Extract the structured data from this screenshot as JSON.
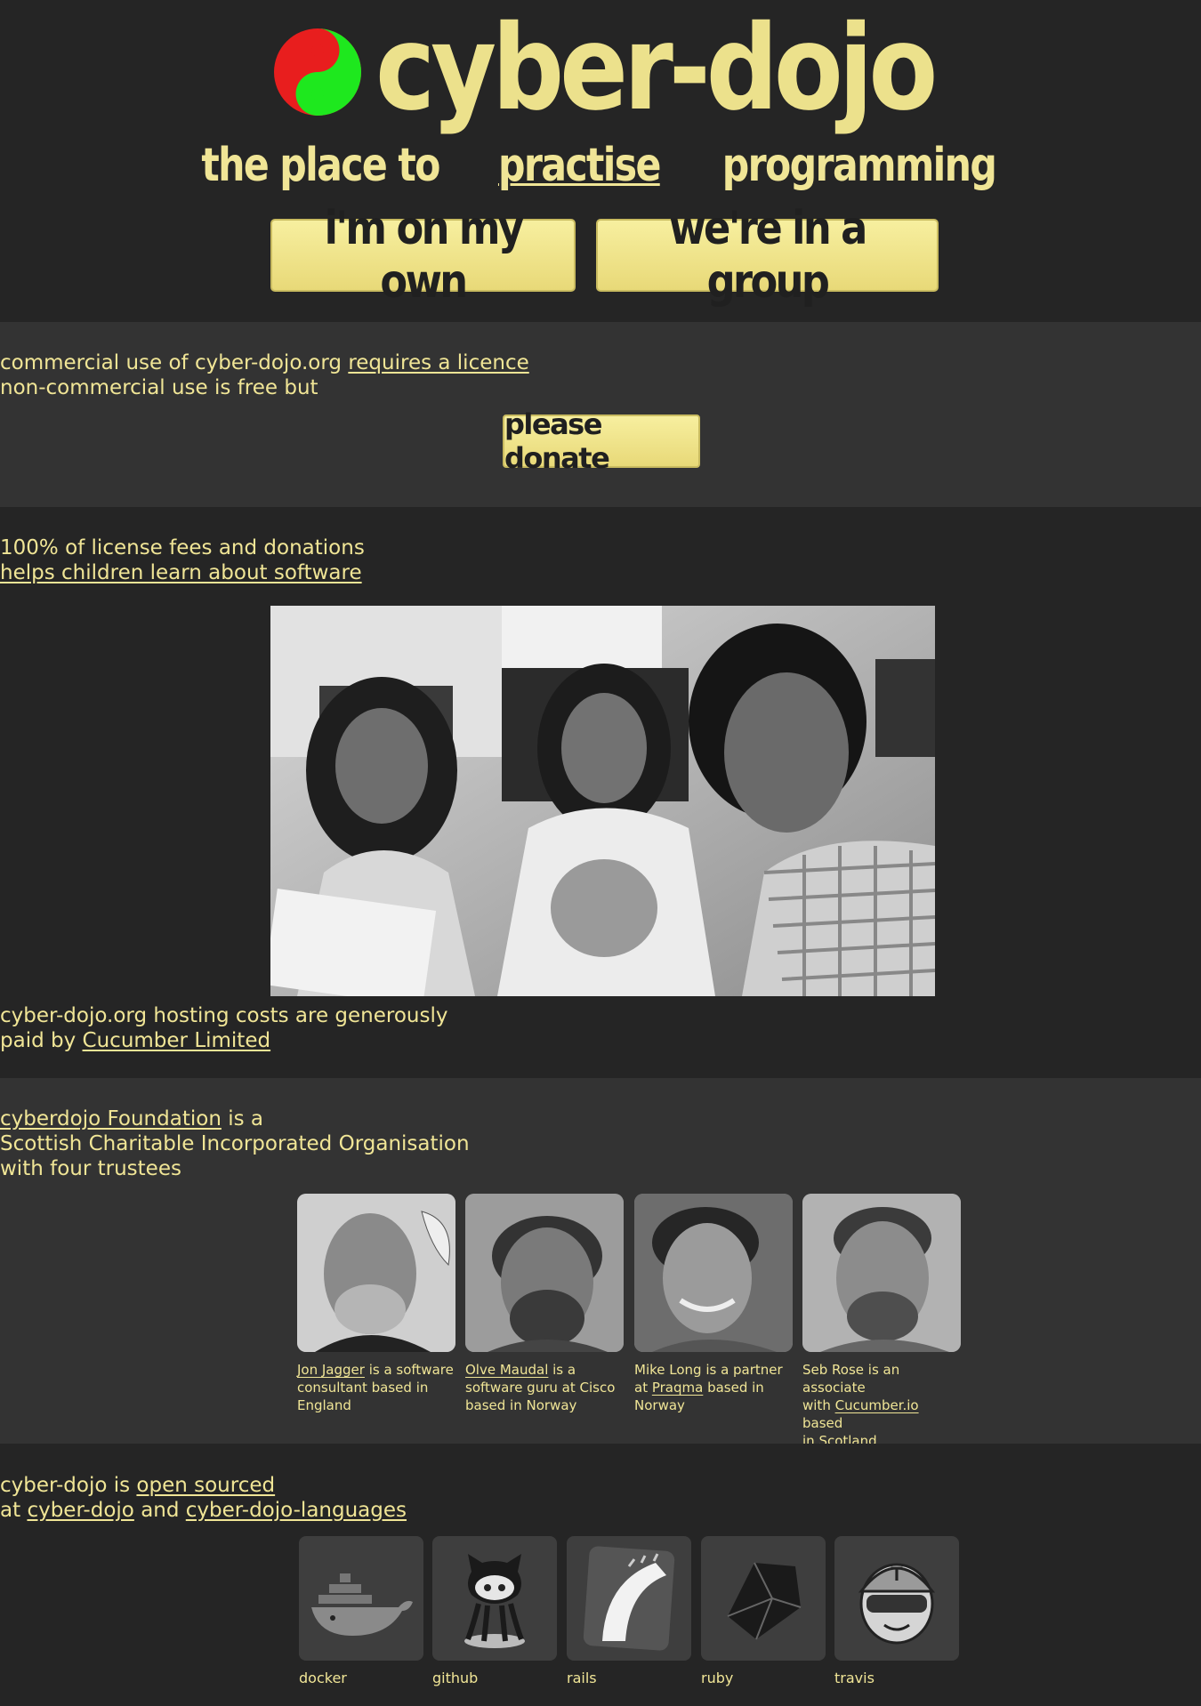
{
  "header": {
    "title": "cyber-dojo",
    "tagline_before": "the place to",
    "tagline_link": "practise",
    "tagline_after": "programming",
    "buttons": {
      "own": "i'm on my own",
      "group": "we're in a group"
    }
  },
  "licence": {
    "line1_text": "commercial use of cyber-dojo.org",
    "line1_link": "requires a licence",
    "line2": "non-commercial use is free but",
    "donate_label": "please donate"
  },
  "children": {
    "line1": "100% of license fees and donations",
    "line2_link": "helps children learn about software",
    "hosting_line1": "cyber-dojo.org hosting costs are generously",
    "hosting_prefix": "paid by",
    "hosting_link": "Cucumber Limited"
  },
  "foundation": {
    "link": "cyberdojo Foundation",
    "line1_after": "is a",
    "line2": "Scottish Charitable Incorporated Organisation",
    "line3": "with four trustees",
    "trustees": [
      {
        "link": "Jon Jagger",
        "a": " is a software",
        "b": "consultant based in",
        "c": "England"
      },
      {
        "link": "Olve Maudal",
        "a": " is a",
        "b": "software guru at Cisco",
        "c": "based in Norway"
      },
      {
        "pre": "Mike Long is a partner",
        "b_pre": "at ",
        "link": "Praqma",
        "b_post": " based in",
        "c": "Norway"
      },
      {
        "pre": "Seb Rose is an associate",
        "b_pre": "with ",
        "link": "Cucumber.io",
        "b_post": " based",
        "c": "in Scotland"
      }
    ]
  },
  "opensource": {
    "line1_before": "cyber-dojo is",
    "line1_link": "open sourced",
    "line2_before": "at",
    "link1": "cyber-dojo",
    "line2_mid": "and",
    "link2": "cyber-dojo-languages",
    "tools": [
      "docker",
      "github",
      "rails",
      "ruby",
      "travis"
    ]
  },
  "colors": {
    "accent": "#f0e596",
    "bg_dark": "#252525",
    "bg_mid": "#333333",
    "button_text": "#202020"
  }
}
